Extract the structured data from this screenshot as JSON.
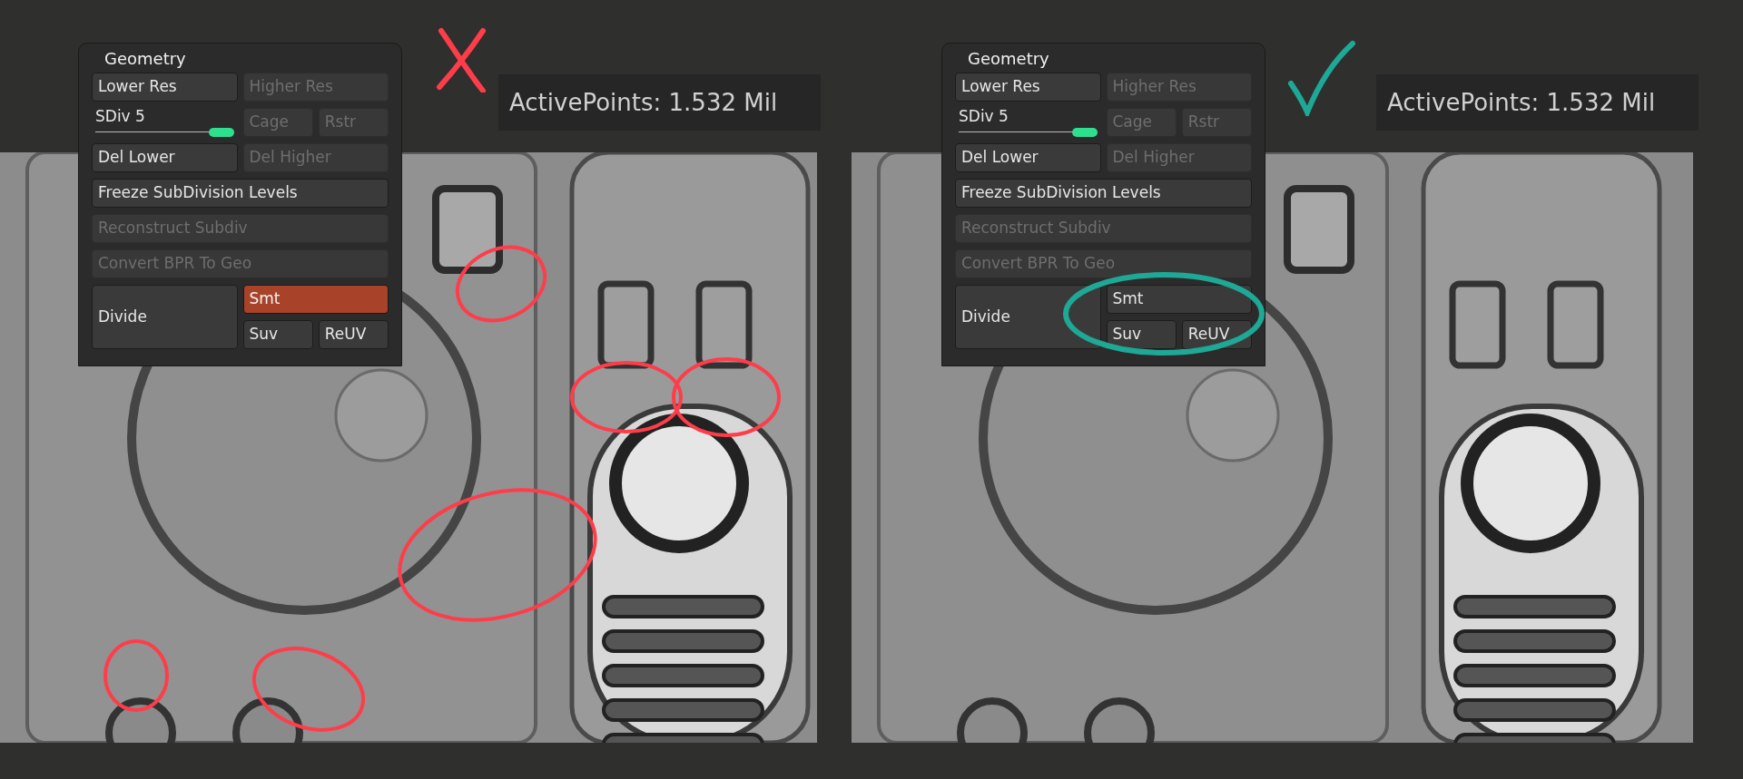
{
  "comparisons": [
    {
      "verdict": {
        "kind": "cross",
        "color": "#ff3d4a"
      },
      "panel": {
        "title": "Geometry",
        "items": [
          {
            "kind": "button",
            "label": "Lower Res",
            "disabled": false,
            "selected": false
          },
          {
            "kind": "button",
            "label": "Higher Res",
            "disabled": true,
            "selected": false
          },
          {
            "kind": "slider",
            "label": "SDiv",
            "value": "5",
            "level": 1
          },
          {
            "kind": "button",
            "label": "Cage",
            "disabled": true,
            "selected": false
          },
          {
            "kind": "button",
            "label": "Rstr",
            "disabled": true,
            "selected": false
          },
          {
            "kind": "button",
            "label": "Del Lower",
            "disabled": false,
            "selected": false
          },
          {
            "kind": "button",
            "label": "Del Higher",
            "disabled": true,
            "selected": false
          },
          {
            "kind": "button",
            "label": "Freeze SubDivision Levels",
            "disabled": false,
            "selected": false
          },
          {
            "kind": "button",
            "label": "Reconstruct Subdiv",
            "disabled": true,
            "selected": false
          },
          {
            "kind": "button",
            "label": "Convert BPR To Geo",
            "disabled": true,
            "selected": false
          },
          {
            "kind": "button",
            "label": "Divide",
            "disabled": false,
            "selected": false
          },
          {
            "kind": "button",
            "label": "Smt",
            "disabled": false,
            "selected": true
          },
          {
            "kind": "button",
            "label": "Suv",
            "disabled": false,
            "selected": false
          },
          {
            "kind": "button",
            "label": "ReUV",
            "disabled": false,
            "selected": false
          }
        ]
      },
      "active_points": "ActivePoints: 1.532 Mil"
    },
    {
      "verdict": {
        "kind": "check",
        "color": "#1ea896"
      },
      "panel": {
        "title": "Geometry",
        "items": [
          {
            "kind": "button",
            "label": "Lower Res",
            "disabled": false,
            "selected": false
          },
          {
            "kind": "button",
            "label": "Higher Res",
            "disabled": true,
            "selected": false
          },
          {
            "kind": "slider",
            "label": "SDiv",
            "value": "5",
            "level": 1
          },
          {
            "kind": "button",
            "label": "Cage",
            "disabled": true,
            "selected": false
          },
          {
            "kind": "button",
            "label": "Rstr",
            "disabled": true,
            "selected": false
          },
          {
            "kind": "button",
            "label": "Del Lower",
            "disabled": false,
            "selected": false
          },
          {
            "kind": "button",
            "label": "Del Higher",
            "disabled": true,
            "selected": false
          },
          {
            "kind": "button",
            "label": "Freeze SubDivision Levels",
            "disabled": false,
            "selected": false
          },
          {
            "kind": "button",
            "label": "Reconstruct Subdiv",
            "disabled": true,
            "selected": false
          },
          {
            "kind": "button",
            "label": "Convert BPR To Geo",
            "disabled": true,
            "selected": false
          },
          {
            "kind": "button",
            "label": "Divide",
            "disabled": false,
            "selected": false
          },
          {
            "kind": "button",
            "label": "Smt",
            "disabled": false,
            "selected": false
          },
          {
            "kind": "button",
            "label": "Suv",
            "disabled": false,
            "selected": false
          },
          {
            "kind": "button",
            "label": "ReUV",
            "disabled": false,
            "selected": false
          }
        ]
      },
      "active_points": "ActivePoints: 1.532 Mil"
    }
  ]
}
